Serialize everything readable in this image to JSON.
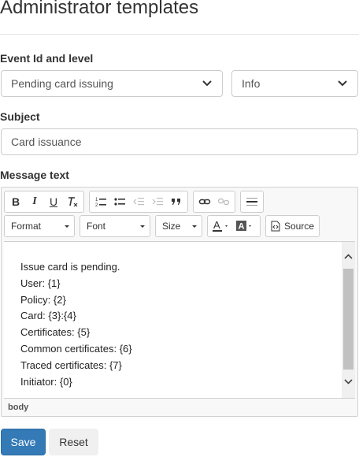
{
  "page": {
    "title": "Administrator templates"
  },
  "event_section": {
    "label": "Event Id and level",
    "event_select": {
      "value": "Pending card issuing"
    },
    "level_select": {
      "value": "Info"
    }
  },
  "subject_section": {
    "label": "Subject",
    "value": "Card issuance"
  },
  "message_section": {
    "label": "Message text"
  },
  "editor": {
    "toolbar": {
      "bold": "B",
      "italic": "I",
      "underline": "U",
      "format": "Format",
      "font": "Font",
      "size": "Size",
      "source": "Source"
    },
    "content_lines": [
      "Issue card is pending.",
      "User: {1}",
      "Policy: {2}",
      "Card: {3}:{4}",
      "Certificates: {5}",
      "Common certificates: {6}",
      "Traced certificates: {7}",
      "Initiator: {0}"
    ],
    "status_path": "body"
  },
  "actions": {
    "save": "Save",
    "reset": "Reset"
  },
  "colors": {
    "primary": "#337ab7",
    "border": "#cccccc"
  }
}
